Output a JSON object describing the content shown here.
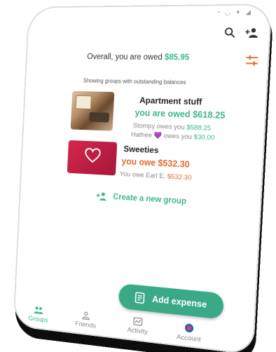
{
  "header": {
    "search_icon": "search-icon",
    "add_friend_icon": "add-friend-icon"
  },
  "summary": {
    "prefix": "Overall, you are owed",
    "amount": "$85.95",
    "filter_icon": "filter-icon"
  },
  "filter_note": "Showing groups with outstanding balances",
  "groups": [
    {
      "name": "Apartment stuff",
      "status": "you are owed $618.25",
      "lines": [
        {
          "text": "Stompy owes you",
          "amount": "$588.25"
        },
        {
          "text": "Hathee",
          "emoji": "💜",
          "text2": "owes you",
          "amount": "$30.00"
        }
      ]
    },
    {
      "name": "Sweeties",
      "status": "you owe $532.30",
      "lines": [
        {
          "text": "You owe Earl E.",
          "amount": "$532.30"
        }
      ]
    }
  ],
  "create_group_label": "Create a new group",
  "fab_label": "Add expense",
  "tabs": [
    {
      "label": "Groups",
      "icon": "groups-icon",
      "active": true
    },
    {
      "label": "Friends",
      "icon": "friends-icon",
      "active": false
    },
    {
      "label": "Activity",
      "icon": "activity-icon",
      "active": false
    },
    {
      "label": "Account",
      "icon": "account-avatar-icon",
      "active": false
    }
  ],
  "colors": {
    "accent": "#3fb58e",
    "owe": "#e56a2f",
    "fab": "#3aa985"
  }
}
